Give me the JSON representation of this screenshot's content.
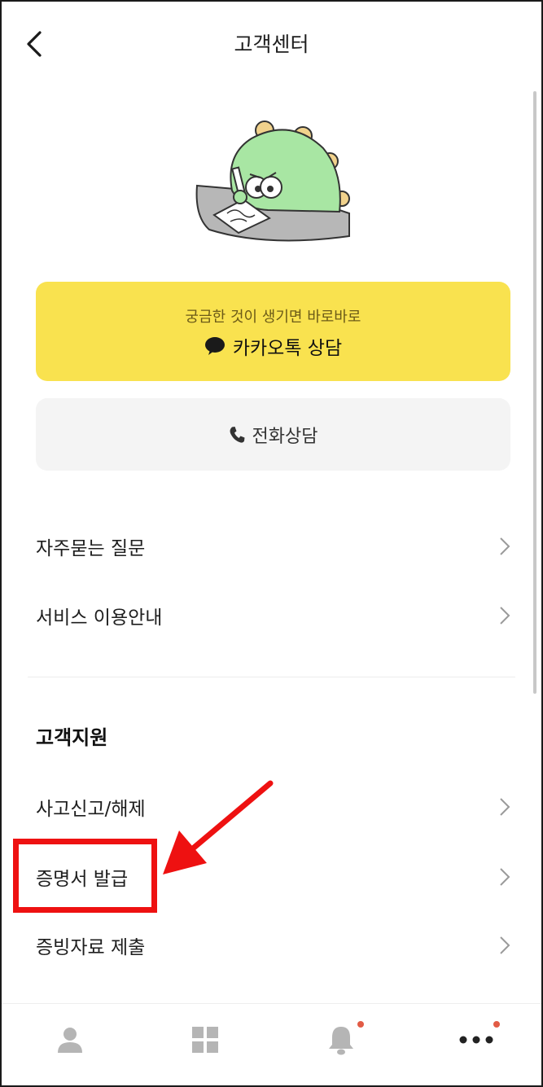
{
  "header": {
    "title": "고객센터",
    "back_icon": "chevron-left-icon"
  },
  "illustration": {
    "icon": "dinosaur-writing-mascot",
    "body_color": "#a8e6a3",
    "spike_color": "#f1d28c"
  },
  "kakao_consult": {
    "subtitle": "궁금한 것이 생기면 바로바로",
    "label": "카카오톡 상담",
    "icon": "speech-bubble-icon",
    "background_color": "#f9e24f"
  },
  "phone_consult": {
    "label": "전화상담",
    "icon": "phone-icon",
    "background_color": "#f4f4f4"
  },
  "menu": [
    {
      "label": "자주묻는 질문"
    },
    {
      "label": "서비스 이용안내"
    }
  ],
  "customer_support": {
    "title": "고객지원",
    "items": [
      {
        "label": "사고신고/해제"
      },
      {
        "label": "증명서 발급"
      },
      {
        "label": "증빙자료 제출"
      }
    ]
  },
  "annotation": {
    "highlight_color": "#ee1111"
  },
  "tabbar": {
    "tabs": [
      {
        "icon": "person-icon"
      },
      {
        "icon": "grid-icon"
      },
      {
        "icon": "bell-icon",
        "badge": true
      },
      {
        "icon": "more-dots-icon",
        "badge": true
      }
    ],
    "badge_color": "#e25b45"
  }
}
